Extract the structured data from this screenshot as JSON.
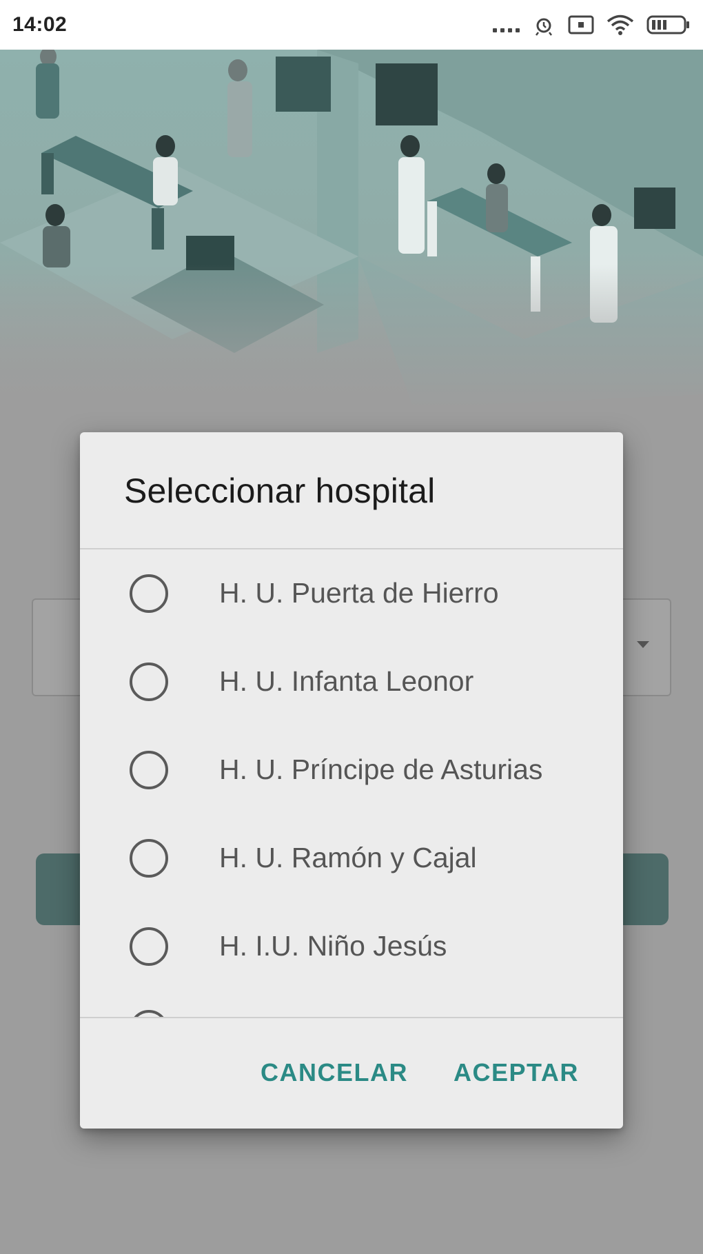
{
  "status_bar": {
    "time": "14:02",
    "icons": [
      "signal-dots-icon",
      "alarm-icon",
      "screen-icon",
      "wifi-icon",
      "battery-icon"
    ]
  },
  "background": {
    "illustration": "hospital-waiting-room-illustration",
    "accent_color": "#4d6b69"
  },
  "dialog": {
    "title": "Seleccionar hospital",
    "options": [
      {
        "label": "H. U. Puerta de Hierro",
        "selected": false
      },
      {
        "label": "H. U. Infanta Leonor",
        "selected": false
      },
      {
        "label": "H. U. Príncipe de Asturias",
        "selected": false
      },
      {
        "label": "H. U. Ramón y Cajal",
        "selected": false
      },
      {
        "label": "H. I.U. Niño Jesús",
        "selected": false
      }
    ],
    "cancel_label": "CANCELAR",
    "accept_label": "ACEPTAR",
    "button_color": "#2b8a85"
  }
}
